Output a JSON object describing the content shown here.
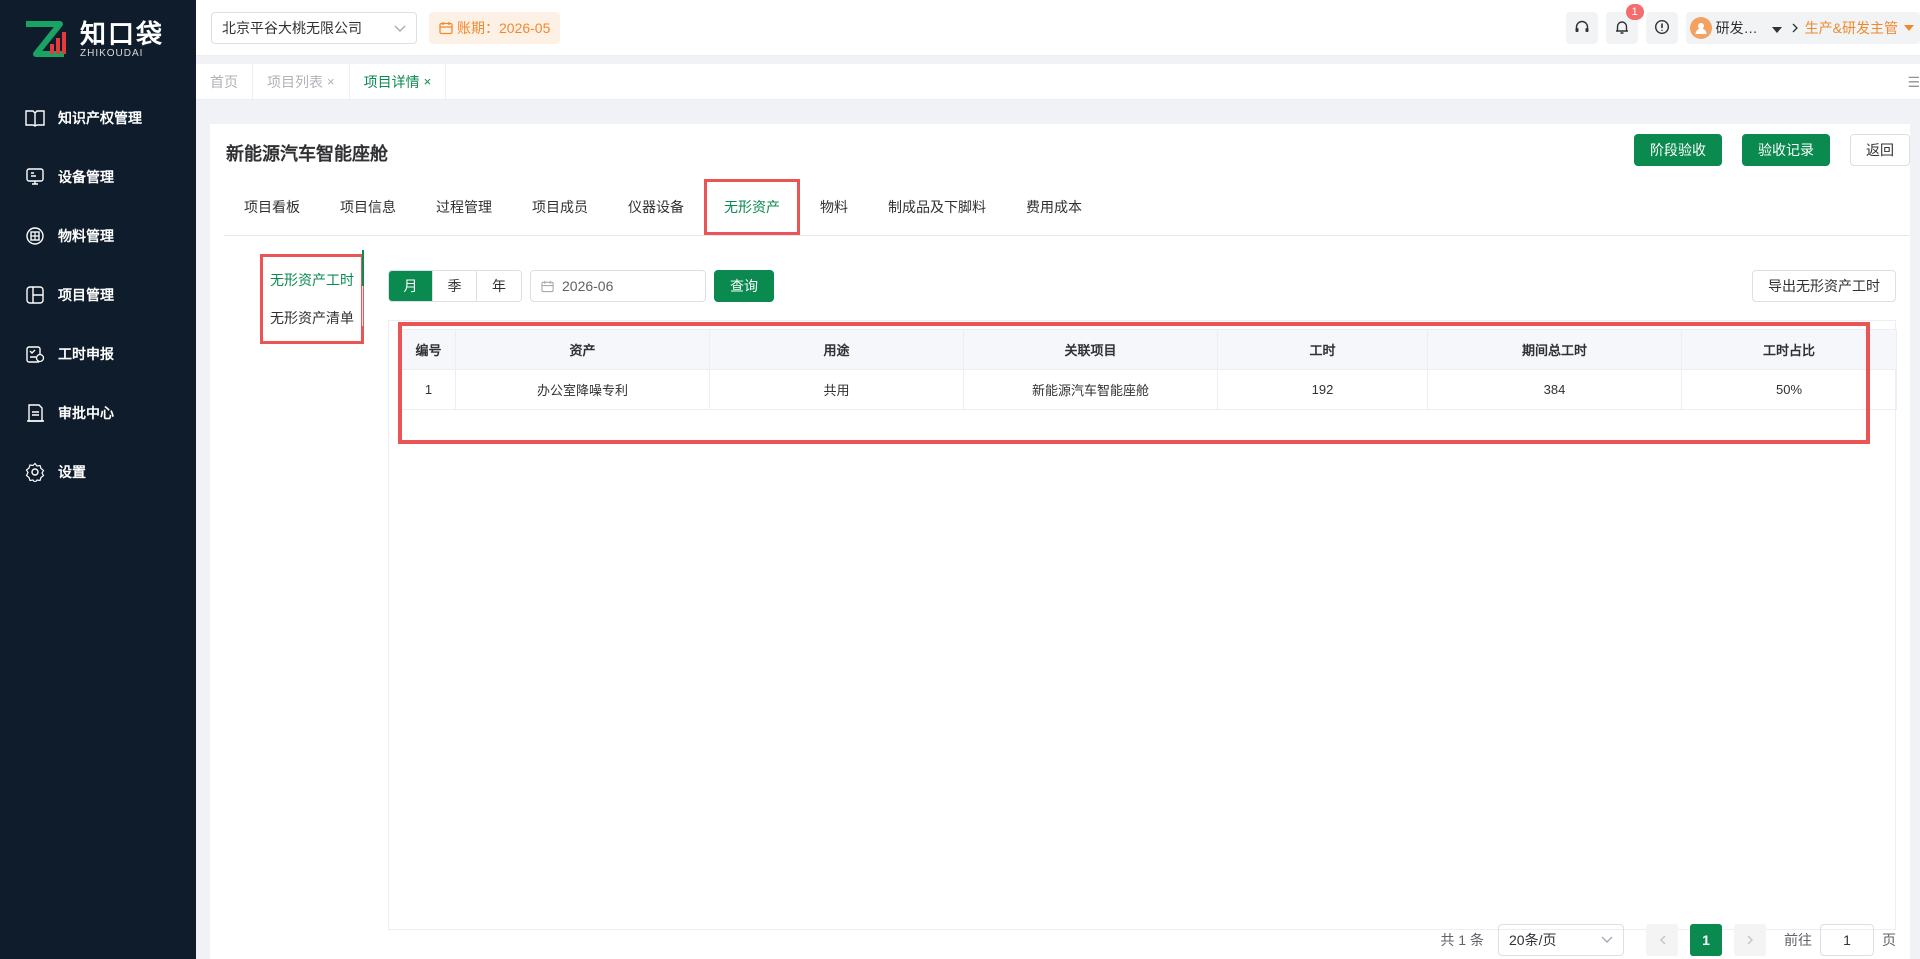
{
  "brand": {
    "name_cn": "知口袋",
    "name_en": "ZHIKOUDAI"
  },
  "sidebar": {
    "items": [
      {
        "label": "知识产权管理",
        "icon": "book-icon"
      },
      {
        "label": "设备管理",
        "icon": "device-icon"
      },
      {
        "label": "物料管理",
        "icon": "box-icon"
      },
      {
        "label": "项目管理",
        "icon": "layout-icon"
      },
      {
        "label": "工时申报",
        "icon": "timesheet-icon"
      },
      {
        "label": "审批中心",
        "icon": "approval-icon"
      },
      {
        "label": "设置",
        "icon": "gear-icon"
      }
    ]
  },
  "header": {
    "company": "北京平谷大桃无限公司",
    "period": "账期：2026-05",
    "notification_count": "1",
    "user_name": "研发…",
    "role": "生产&研发主管"
  },
  "view_tabs": [
    {
      "label": "首页",
      "closable": false
    },
    {
      "label": "项目列表",
      "closable": true
    },
    {
      "label": "项目详情",
      "closable": true,
      "active": true
    }
  ],
  "page": {
    "title": "新能源汽车智能座舱",
    "buttons": {
      "stage_accept": "阶段验收",
      "accept_record": "验收记录",
      "back": "返回"
    }
  },
  "main_tabs": [
    "项目看板",
    "项目信息",
    "过程管理",
    "项目成员",
    "仪器设备",
    "无形资产",
    "物料",
    "制成品及下脚料",
    "费用成本"
  ],
  "sub_nav": [
    "无形资产工时",
    "无形资产清单"
  ],
  "filters": {
    "periods": [
      "月",
      "季",
      "年"
    ],
    "date_value": "2026-06",
    "query_label": "查询",
    "export_label": "导出无形资产工时"
  },
  "table": {
    "headers": [
      "编号",
      "资产",
      "用途",
      "关联项目",
      "工时",
      "期间总工时",
      "工时占比"
    ],
    "rows": [
      [
        "1",
        "办公室降噪专利",
        "共用",
        "新能源汽车智能座舱",
        "192",
        "384",
        "50%"
      ]
    ]
  },
  "pagination": {
    "total": "共 1 条",
    "page_size": "20条/页",
    "current_page": "1",
    "goto_label": "前往",
    "goto_value": "1",
    "page_unit": "页"
  },
  "colors": {
    "primary": "#0a8a4f",
    "sidebar": "#0f1c2b",
    "highlight": "#ea5455",
    "warning": "#f0892e"
  }
}
